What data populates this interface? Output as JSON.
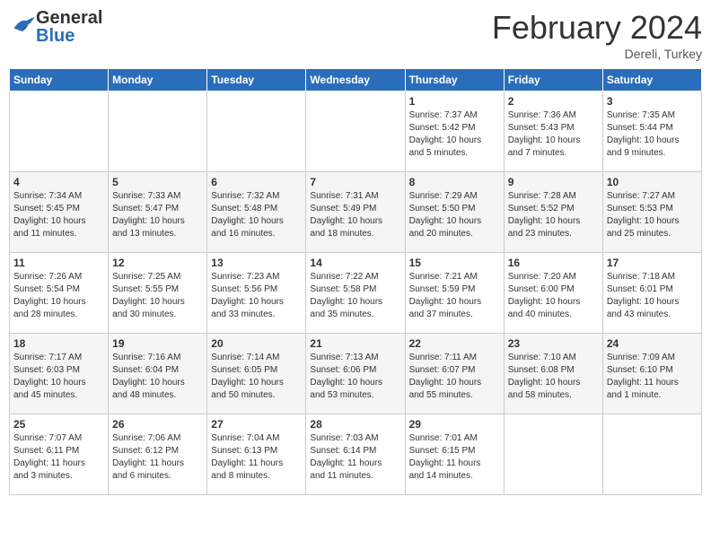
{
  "header": {
    "logo_line1": "General",
    "logo_line2": "Blue",
    "month": "February 2024",
    "location": "Dereli, Turkey"
  },
  "days_of_week": [
    "Sunday",
    "Monday",
    "Tuesday",
    "Wednesday",
    "Thursday",
    "Friday",
    "Saturday"
  ],
  "weeks": [
    [
      {
        "day": "",
        "info": ""
      },
      {
        "day": "",
        "info": ""
      },
      {
        "day": "",
        "info": ""
      },
      {
        "day": "",
        "info": ""
      },
      {
        "day": "1",
        "info": "Sunrise: 7:37 AM\nSunset: 5:42 PM\nDaylight: 10 hours\nand 5 minutes."
      },
      {
        "day": "2",
        "info": "Sunrise: 7:36 AM\nSunset: 5:43 PM\nDaylight: 10 hours\nand 7 minutes."
      },
      {
        "day": "3",
        "info": "Sunrise: 7:35 AM\nSunset: 5:44 PM\nDaylight: 10 hours\nand 9 minutes."
      }
    ],
    [
      {
        "day": "4",
        "info": "Sunrise: 7:34 AM\nSunset: 5:45 PM\nDaylight: 10 hours\nand 11 minutes."
      },
      {
        "day": "5",
        "info": "Sunrise: 7:33 AM\nSunset: 5:47 PM\nDaylight: 10 hours\nand 13 minutes."
      },
      {
        "day": "6",
        "info": "Sunrise: 7:32 AM\nSunset: 5:48 PM\nDaylight: 10 hours\nand 16 minutes."
      },
      {
        "day": "7",
        "info": "Sunrise: 7:31 AM\nSunset: 5:49 PM\nDaylight: 10 hours\nand 18 minutes."
      },
      {
        "day": "8",
        "info": "Sunrise: 7:29 AM\nSunset: 5:50 PM\nDaylight: 10 hours\nand 20 minutes."
      },
      {
        "day": "9",
        "info": "Sunrise: 7:28 AM\nSunset: 5:52 PM\nDaylight: 10 hours\nand 23 minutes."
      },
      {
        "day": "10",
        "info": "Sunrise: 7:27 AM\nSunset: 5:53 PM\nDaylight: 10 hours\nand 25 minutes."
      }
    ],
    [
      {
        "day": "11",
        "info": "Sunrise: 7:26 AM\nSunset: 5:54 PM\nDaylight: 10 hours\nand 28 minutes."
      },
      {
        "day": "12",
        "info": "Sunrise: 7:25 AM\nSunset: 5:55 PM\nDaylight: 10 hours\nand 30 minutes."
      },
      {
        "day": "13",
        "info": "Sunrise: 7:23 AM\nSunset: 5:56 PM\nDaylight: 10 hours\nand 33 minutes."
      },
      {
        "day": "14",
        "info": "Sunrise: 7:22 AM\nSunset: 5:58 PM\nDaylight: 10 hours\nand 35 minutes."
      },
      {
        "day": "15",
        "info": "Sunrise: 7:21 AM\nSunset: 5:59 PM\nDaylight: 10 hours\nand 37 minutes."
      },
      {
        "day": "16",
        "info": "Sunrise: 7:20 AM\nSunset: 6:00 PM\nDaylight: 10 hours\nand 40 minutes."
      },
      {
        "day": "17",
        "info": "Sunrise: 7:18 AM\nSunset: 6:01 PM\nDaylight: 10 hours\nand 43 minutes."
      }
    ],
    [
      {
        "day": "18",
        "info": "Sunrise: 7:17 AM\nSunset: 6:03 PM\nDaylight: 10 hours\nand 45 minutes."
      },
      {
        "day": "19",
        "info": "Sunrise: 7:16 AM\nSunset: 6:04 PM\nDaylight: 10 hours\nand 48 minutes."
      },
      {
        "day": "20",
        "info": "Sunrise: 7:14 AM\nSunset: 6:05 PM\nDaylight: 10 hours\nand 50 minutes."
      },
      {
        "day": "21",
        "info": "Sunrise: 7:13 AM\nSunset: 6:06 PM\nDaylight: 10 hours\nand 53 minutes."
      },
      {
        "day": "22",
        "info": "Sunrise: 7:11 AM\nSunset: 6:07 PM\nDaylight: 10 hours\nand 55 minutes."
      },
      {
        "day": "23",
        "info": "Sunrise: 7:10 AM\nSunset: 6:08 PM\nDaylight: 10 hours\nand 58 minutes."
      },
      {
        "day": "24",
        "info": "Sunrise: 7:09 AM\nSunset: 6:10 PM\nDaylight: 11 hours\nand 1 minute."
      }
    ],
    [
      {
        "day": "25",
        "info": "Sunrise: 7:07 AM\nSunset: 6:11 PM\nDaylight: 11 hours\nand 3 minutes."
      },
      {
        "day": "26",
        "info": "Sunrise: 7:06 AM\nSunset: 6:12 PM\nDaylight: 11 hours\nand 6 minutes."
      },
      {
        "day": "27",
        "info": "Sunrise: 7:04 AM\nSunset: 6:13 PM\nDaylight: 11 hours\nand 8 minutes."
      },
      {
        "day": "28",
        "info": "Sunrise: 7:03 AM\nSunset: 6:14 PM\nDaylight: 11 hours\nand 11 minutes."
      },
      {
        "day": "29",
        "info": "Sunrise: 7:01 AM\nSunset: 6:15 PM\nDaylight: 11 hours\nand 14 minutes."
      },
      {
        "day": "",
        "info": ""
      },
      {
        "day": "",
        "info": ""
      }
    ]
  ]
}
